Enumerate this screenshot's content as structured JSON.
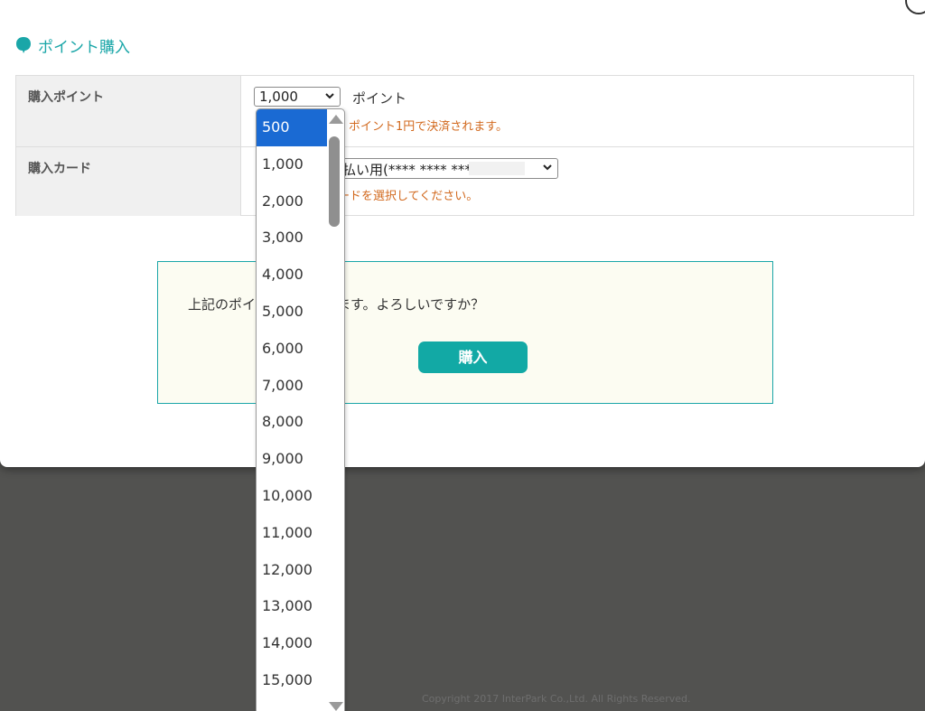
{
  "section": {
    "title": "ポイント購入"
  },
  "form": {
    "rows": [
      {
        "label": "購入ポイント",
        "selected_value": "1,000",
        "unit": "ポイント",
        "note": "ポイント1円で決済されます。"
      },
      {
        "label": "購入カード",
        "selected_value": "払い用(**** **** ****",
        "note": "ードを選択してください。"
      }
    ]
  },
  "confirm": {
    "text_left": "上記のポイ",
    "text_right": "します。よろしいですか？",
    "button_label": "購入"
  },
  "dropdown": {
    "options": [
      "500",
      "1,000",
      "2,000",
      "3,000",
      "4,000",
      "5,000",
      "6,000",
      "7,000",
      "8,000",
      "9,000",
      "10,000",
      "11,000",
      "12,000",
      "13,000",
      "14,000",
      "15,000"
    ],
    "highlighted": "500"
  },
  "footer": {
    "copyright": "Copyright 2017 InterPark Co.,Ltd. All Rights Reserved."
  },
  "colors": {
    "accent": "#1aa6a8",
    "note": "#d2691e",
    "highlight": "#1a6ad3"
  }
}
